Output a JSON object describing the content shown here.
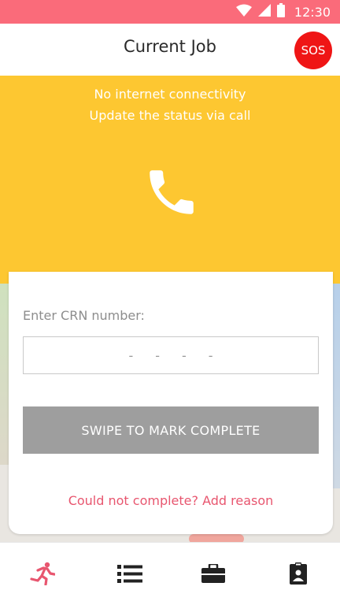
{
  "status_bar": {
    "time": "12:30",
    "icons": [
      "wifi-icon",
      "signal-icon",
      "battery-icon"
    ],
    "color": "#fa6b7a"
  },
  "header": {
    "title": "Current Job",
    "sos_label": "SOS",
    "sos_color": "#ef1515"
  },
  "offline_banner": {
    "line1": "No internet connectivity",
    "line2": "Update the status via call",
    "icon": "phone-icon",
    "color": "#fdc731"
  },
  "job_card": {
    "crn_label": "Enter CRN number:",
    "crn_placeholder": "----",
    "crn_value": "",
    "swipe_label": "SWIPE TO MARK COMPLETE",
    "reason_link": "Could not complete? Add reason",
    "accent_color": "#e8566f"
  },
  "bottom_nav": {
    "items": [
      {
        "icon": "running-person-icon",
        "active": true
      },
      {
        "icon": "list-icon",
        "active": false
      },
      {
        "icon": "briefcase-icon",
        "active": false
      },
      {
        "icon": "id-badge-icon",
        "active": false
      }
    ]
  }
}
